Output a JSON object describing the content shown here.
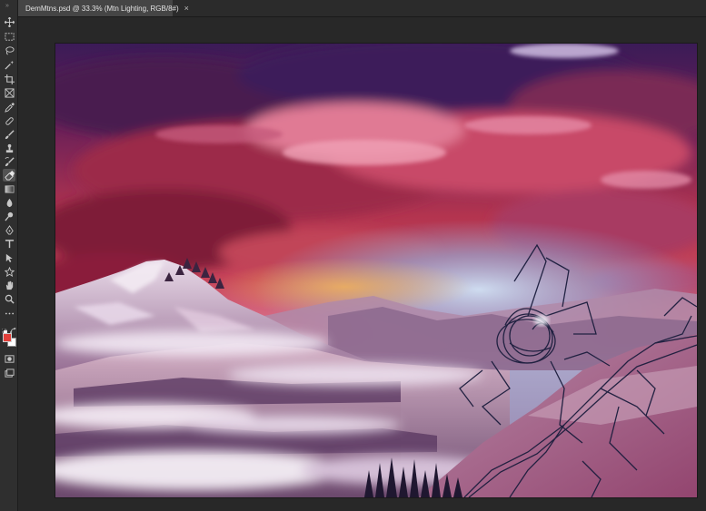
{
  "document": {
    "tab_title": "DemMtns.psd @ 33.3% (Mtn Lighting, RGB/8#)",
    "close_glyph": "×"
  },
  "toolbar": {
    "grip": "»",
    "tools": [
      {
        "name": "move-tool-icon",
        "active": false
      },
      {
        "name": "marquee-tool-icon",
        "active": false
      },
      {
        "name": "lasso-tool-icon",
        "active": false
      },
      {
        "name": "magic-wand-tool-icon",
        "active": false
      },
      {
        "name": "crop-tool-icon",
        "active": false
      },
      {
        "name": "frame-tool-icon",
        "active": false
      },
      {
        "name": "eyedropper-tool-icon",
        "active": false
      },
      {
        "name": "healing-brush-tool-icon",
        "active": false
      },
      {
        "name": "brush-tool-icon",
        "active": false
      },
      {
        "name": "clone-stamp-tool-icon",
        "active": false
      },
      {
        "name": "history-brush-tool-icon",
        "active": false
      },
      {
        "name": "eraser-tool-icon",
        "active": true
      },
      {
        "name": "gradient-tool-icon",
        "active": false
      },
      {
        "name": "blur-tool-icon",
        "active": false
      },
      {
        "name": "dodge-tool-icon",
        "active": false
      },
      {
        "name": "pen-tool-icon",
        "active": false
      },
      {
        "name": "type-tool-icon",
        "active": false
      },
      {
        "name": "path-selection-tool-icon",
        "active": false
      },
      {
        "name": "shape-tool-icon",
        "active": false
      },
      {
        "name": "hand-tool-icon",
        "active": false
      },
      {
        "name": "zoom-tool-icon",
        "active": false
      },
      {
        "name": "more-tools-icon",
        "active": false
      }
    ],
    "foreground_color": "#e2403a",
    "background_color": "#ffffff",
    "quick_mask_icon": "quick-mask-icon",
    "screen_mode_icon": "screen-mode-icon"
  },
  "colors": {
    "panel": "#2f2f2f",
    "workspace": "#282828",
    "tab_active": "#454545",
    "icon": "#c8c8c8"
  }
}
